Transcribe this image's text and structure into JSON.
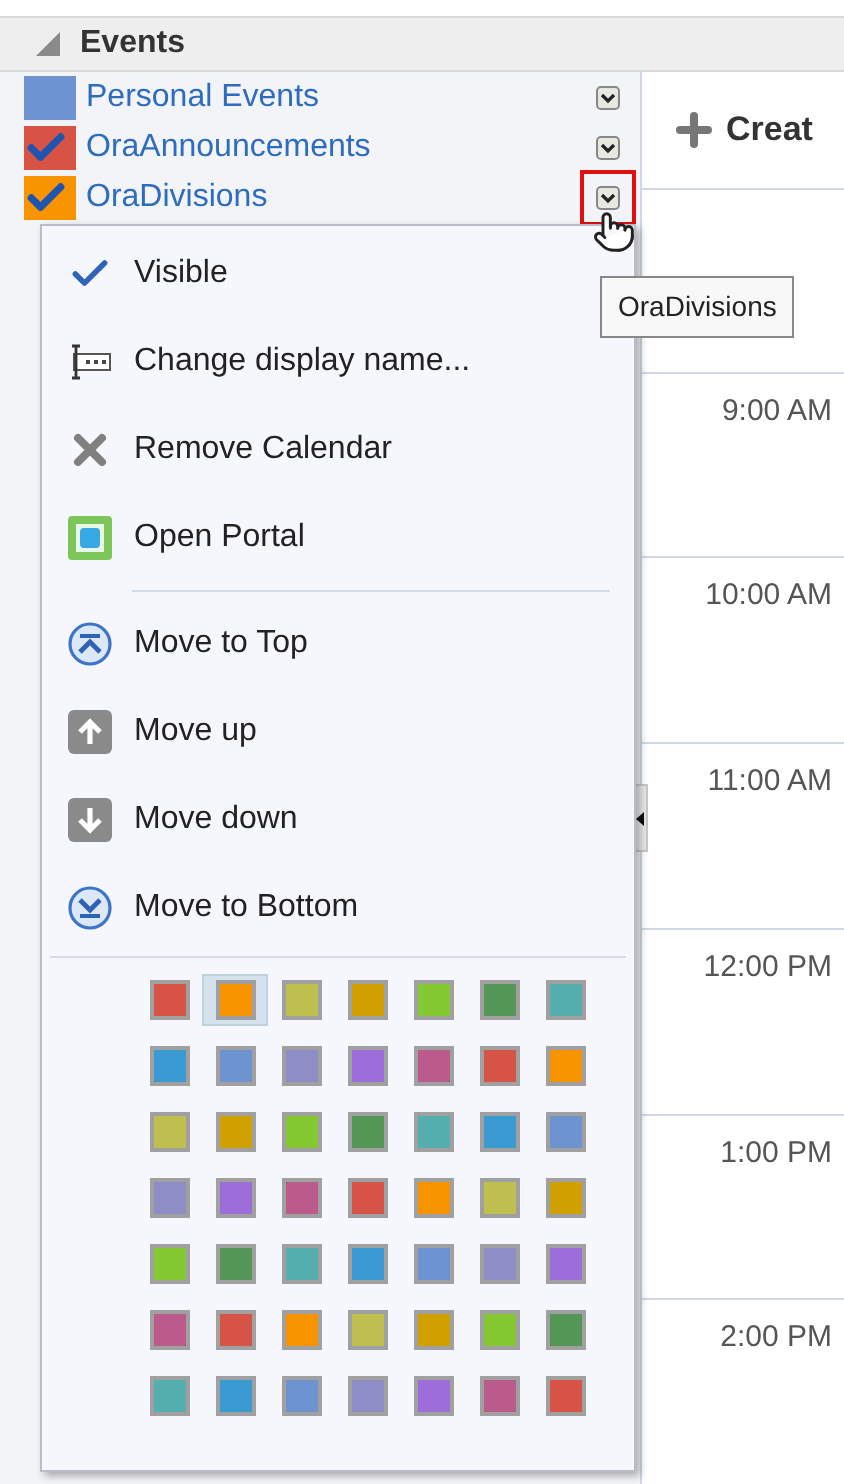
{
  "panel": {
    "title": "Events",
    "expanded": true
  },
  "calendars": [
    {
      "name": "Personal Events",
      "color": "#6d94d0",
      "visible": false,
      "menu_open": false
    },
    {
      "name": "OraAnnouncements",
      "color": "#d65345",
      "visible": true,
      "menu_open": false
    },
    {
      "name": "OraDivisions",
      "color": "#f79400",
      "visible": true,
      "menu_open": true
    }
  ],
  "tooltip": "OraDivisions",
  "menu": {
    "items": [
      {
        "label": "Visible",
        "kind": "check"
      },
      {
        "label": "Change display name...",
        "kind": "rename"
      },
      {
        "label": "Remove Calendar",
        "kind": "remove"
      },
      {
        "label": "Open Portal",
        "kind": "portal"
      },
      {
        "kind": "divider"
      },
      {
        "label": "Move to Top",
        "kind": "top"
      },
      {
        "label": "Move up",
        "kind": "up"
      },
      {
        "label": "Move down",
        "kind": "down"
      },
      {
        "label": "Move to Bottom",
        "kind": "bottom"
      }
    ],
    "swatches": [
      {
        "color": "#d65345",
        "selected": false
      },
      {
        "color": "#f79400",
        "selected": true
      },
      {
        "color": "#bfbf50",
        "selected": false
      },
      {
        "color": "#d0a000",
        "selected": false
      },
      {
        "color": "#84c832",
        "selected": false
      },
      {
        "color": "#549656",
        "selected": false
      },
      {
        "color": "#54aeae",
        "selected": false
      },
      {
        "color": "#3a9bd4",
        "selected": false
      },
      {
        "color": "#6d94d0",
        "selected": false
      },
      {
        "color": "#8e8dc6",
        "selected": false
      },
      {
        "color": "#9d6ed9",
        "selected": false
      },
      {
        "color": "#bd5a8c",
        "selected": false
      },
      {
        "color": "#d65345",
        "selected": false
      },
      {
        "color": "#f79400",
        "selected": false
      },
      {
        "color": "#bfbf50",
        "selected": false
      },
      {
        "color": "#d0a000",
        "selected": false
      },
      {
        "color": "#84c832",
        "selected": false
      },
      {
        "color": "#549656",
        "selected": false
      },
      {
        "color": "#54aeae",
        "selected": false
      },
      {
        "color": "#3a9bd4",
        "selected": false
      },
      {
        "color": "#6d94d0",
        "selected": false
      },
      {
        "color": "#8e8dc6",
        "selected": false
      },
      {
        "color": "#9d6ed9",
        "selected": false
      },
      {
        "color": "#bd5a8c",
        "selected": false
      },
      {
        "color": "#d65345",
        "selected": false
      },
      {
        "color": "#f79400",
        "selected": false
      },
      {
        "color": "#bfbf50",
        "selected": false
      },
      {
        "color": "#d0a000",
        "selected": false
      },
      {
        "color": "#84c832",
        "selected": false
      },
      {
        "color": "#549656",
        "selected": false
      },
      {
        "color": "#54aeae",
        "selected": false
      },
      {
        "color": "#3a9bd4",
        "selected": false
      },
      {
        "color": "#6d94d0",
        "selected": false
      },
      {
        "color": "#8e8dc6",
        "selected": false
      },
      {
        "color": "#9d6ed9",
        "selected": false
      },
      {
        "color": "#bd5a8c",
        "selected": false
      },
      {
        "color": "#d65345",
        "selected": false
      },
      {
        "color": "#f79400",
        "selected": false
      },
      {
        "color": "#bfbf50",
        "selected": false
      },
      {
        "color": "#d0a000",
        "selected": false
      },
      {
        "color": "#84c832",
        "selected": false
      },
      {
        "color": "#549656",
        "selected": false
      },
      {
        "color": "#54aeae",
        "selected": false
      },
      {
        "color": "#3a9bd4",
        "selected": false
      },
      {
        "color": "#6d94d0",
        "selected": false
      },
      {
        "color": "#8e8dc6",
        "selected": false
      },
      {
        "color": "#9d6ed9",
        "selected": false
      },
      {
        "color": "#bd5a8c",
        "selected": false
      },
      {
        "color": "#d65345",
        "selected": false
      }
    ]
  },
  "create_button": "Creat",
  "times": [
    "9:00 AM",
    "10:00 AM",
    "11:00 AM",
    "12:00 PM",
    "1:00 PM",
    "2:00 PM"
  ]
}
